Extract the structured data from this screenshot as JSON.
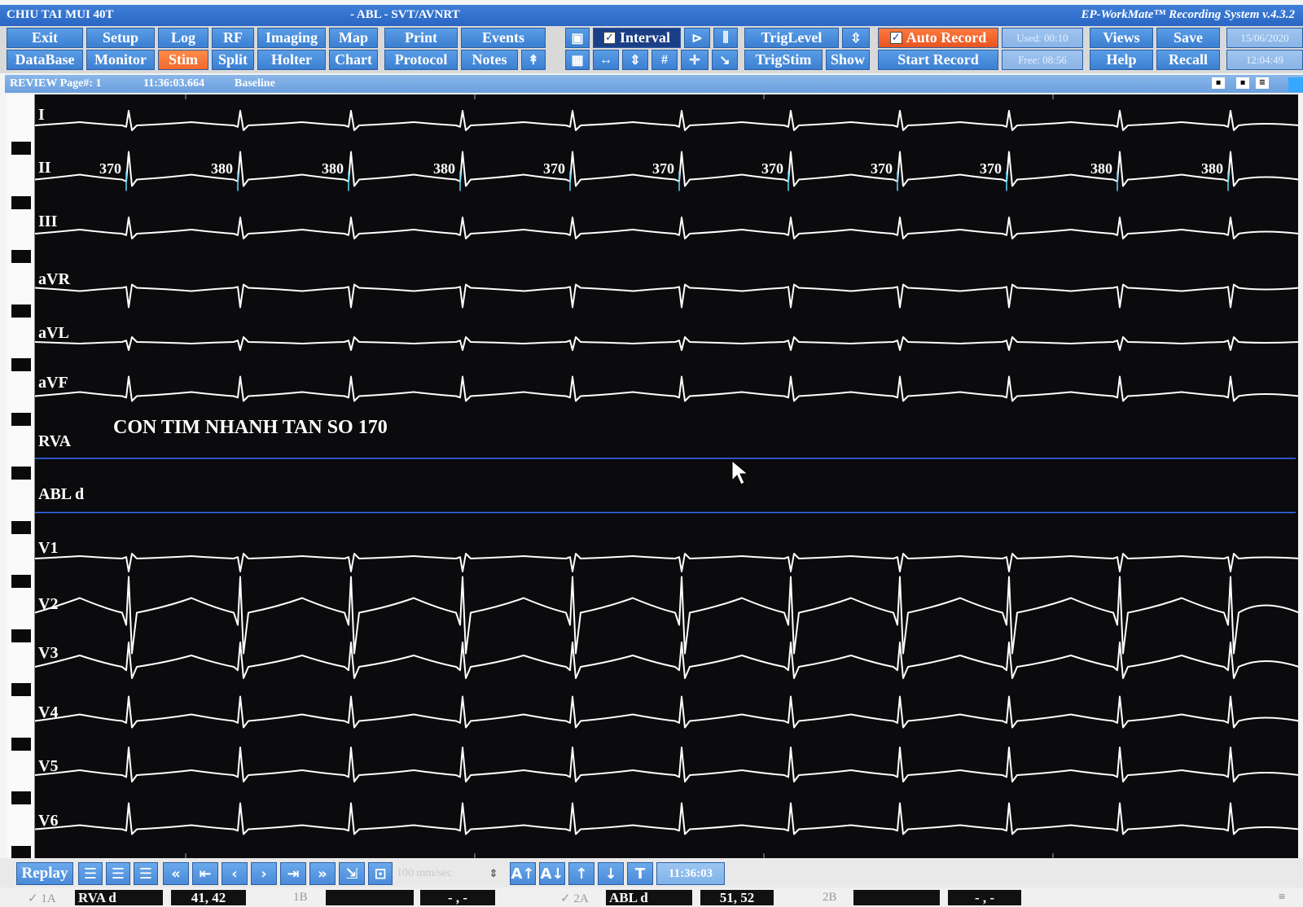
{
  "window": {
    "app_title": "CHIU TAI MUI 40T",
    "study_title": "-  ABL - SVT/AVNRT",
    "system_title": "EP-WorkMate™ Recording System v.4.3.2"
  },
  "toolbar": {
    "row1": [
      "Exit",
      "Setup",
      "Log",
      "RF",
      "Imaging",
      "Map",
      "Print",
      "Events"
    ],
    "row2": [
      "DataBase",
      "Monitor",
      "Stim",
      "Split",
      "Holter",
      "Chart",
      "Protocol",
      "Notes"
    ],
    "interval_label": "Interval",
    "interval_checked": "✓",
    "trig_level": "TrigLevel",
    "trig_stim": "TrigStim",
    "show": "Show",
    "auto_record": "Auto Record",
    "auto_record_checked": "✓",
    "start_record": "Start Record",
    "used": "Used: 00:10",
    "free": "Free: 08:56",
    "views": "Views",
    "help": "Help",
    "save": "Save",
    "recall": "Recall",
    "date": "15/06/2020",
    "clock": "12:04:49"
  },
  "review": {
    "label": "REVIEW Page#: 1",
    "time": "11:36:03.664",
    "mode": "Baseline"
  },
  "leads": [
    "I",
    "II",
    "III",
    "aVR",
    "aVL",
    "aVF",
    "RVA",
    "ABL d",
    "V1",
    "V2",
    "V3",
    "V4",
    "V5",
    "V6"
  ],
  "rr_intervals": [
    "370",
    "380",
    "380",
    "380",
    "370",
    "370",
    "370",
    "370",
    "370",
    "380",
    "380"
  ],
  "annotation": "CON TIM NHANH TAN SO 170",
  "bottom": {
    "replay": "Replay",
    "speed": "100 mm/sec",
    "time": "11:36:03"
  },
  "status": {
    "ch1a_label": "1A",
    "ch1a_name": "RVA d",
    "ch1a_value": "41, 42",
    "ch1b_label": "1B",
    "ch1b_value": "- , -",
    "ch2a_label": "2A",
    "ch2a_name": "ABL d",
    "ch2a_value": "51, 52",
    "ch2b_label": "2B",
    "ch2b_value": "- , -"
  },
  "colors": {
    "toolbar_blue": "#3b7fd2",
    "stim_orange": "#f26a2c",
    "trace_white": "#ffffff",
    "channel_line_blue": "#3b6cff",
    "screen_black": "#0b0b0d"
  }
}
